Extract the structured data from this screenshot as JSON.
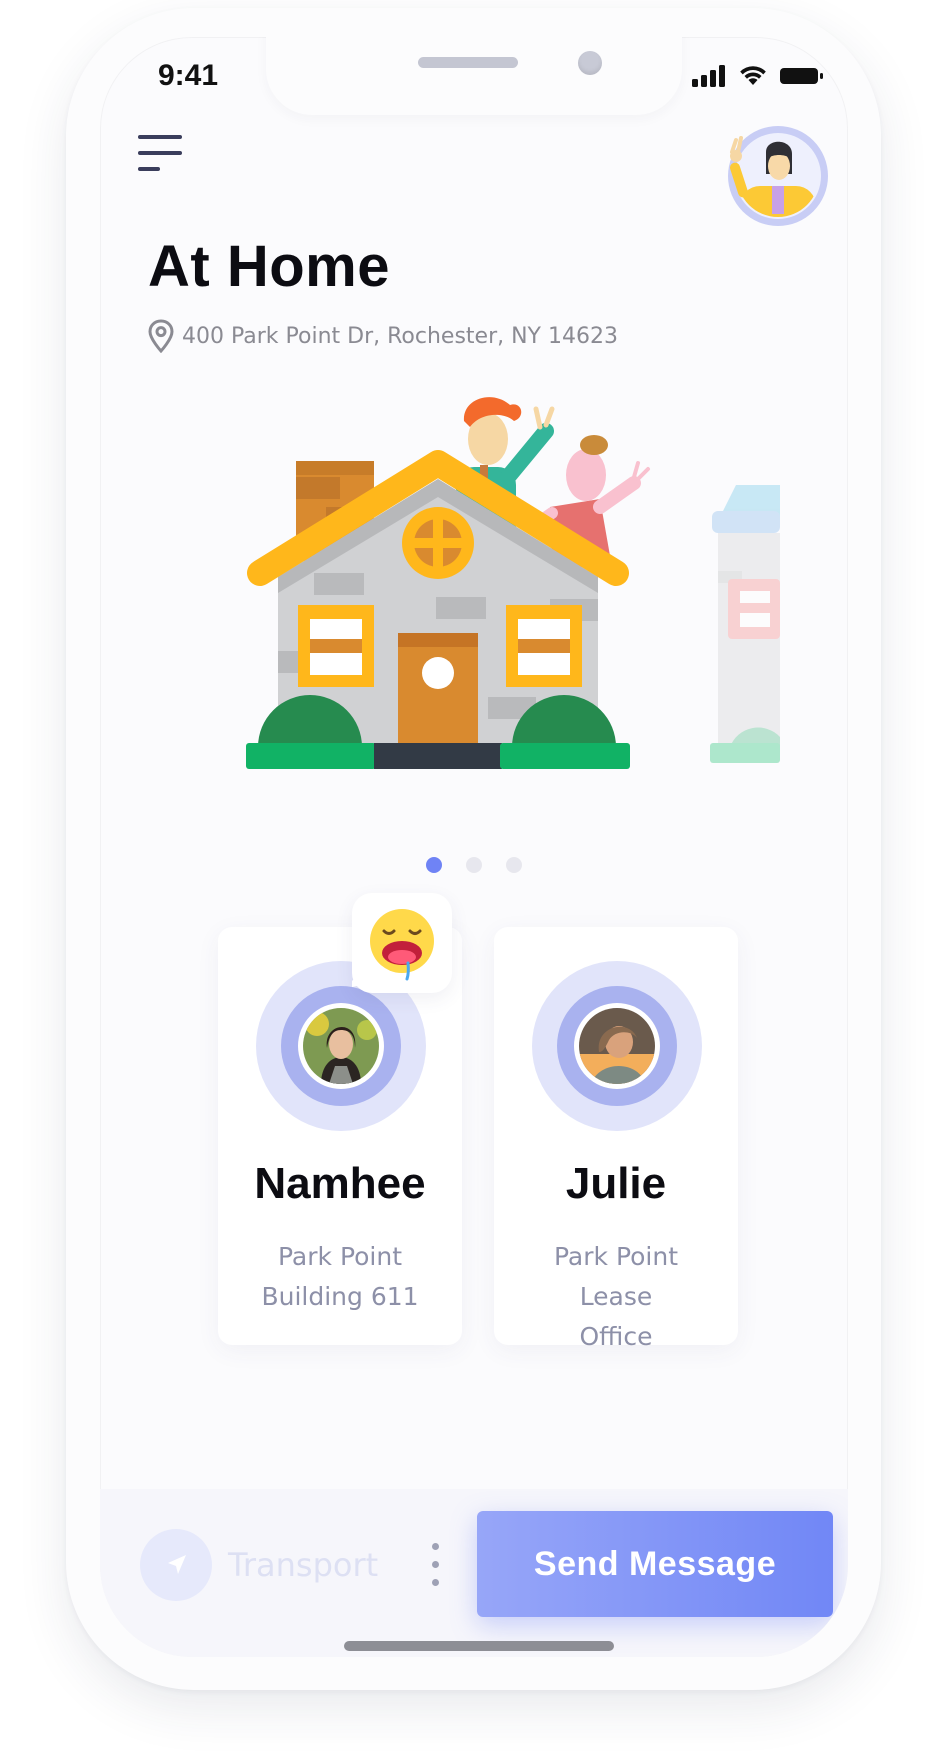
{
  "status_bar": {
    "time": "9:41"
  },
  "header": {
    "title": "At Home",
    "address": "400 Park Point Dr, Rochester, NY 14623"
  },
  "carousel": {
    "pages": 3,
    "active_index": 0
  },
  "contacts": [
    {
      "name": "Namhee",
      "location_line1": "Park Point",
      "location_line2": "Building 611",
      "reaction": "drooling-face"
    },
    {
      "name": "Julie",
      "location_line1": "Park Point Lease",
      "location_line2": "Office"
    }
  ],
  "bottom_bar": {
    "transport_label": "Transport",
    "send_label": "Send Message"
  },
  "colors": {
    "accent": "#7187f6",
    "accent_light": "#97a6f8",
    "house_roof": "#ffb71b",
    "grass": "#11b265"
  }
}
